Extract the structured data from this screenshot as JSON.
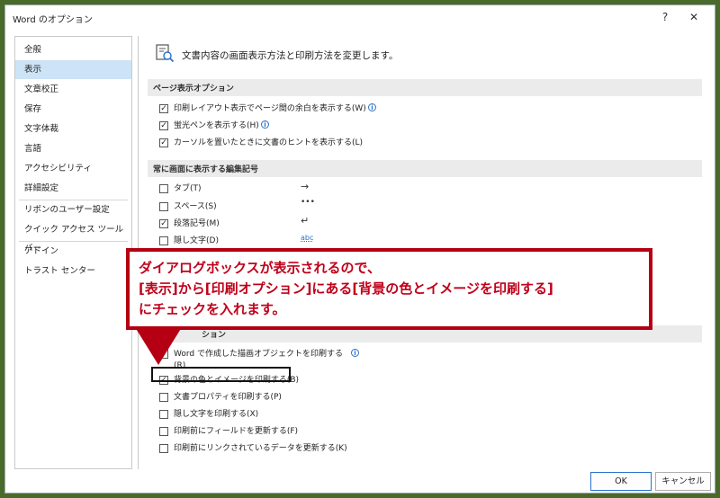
{
  "window": {
    "title": "Word のオプション",
    "help": "?",
    "close": "✕"
  },
  "sidebar": {
    "items": [
      {
        "label": "全般"
      },
      {
        "label": "表示"
      },
      {
        "label": "文章校正"
      },
      {
        "label": "保存"
      },
      {
        "label": "文字体裁"
      },
      {
        "label": "言語"
      },
      {
        "label": "アクセシビリティ"
      },
      {
        "label": "詳細設定"
      },
      {
        "label": "リボンのユーザー設定"
      },
      {
        "label": "クイック アクセス ツール バー"
      },
      {
        "label": "アドイン"
      },
      {
        "label": "トラスト センター"
      }
    ],
    "active": "表示"
  },
  "main": {
    "header": "文書内容の画面表示方法と印刷方法を変更します。",
    "page_options": {
      "title": "ページ表示オプション",
      "items": [
        {
          "label": "印刷レイアウト表示でページ間の余白を表示する(W)",
          "checked": true,
          "info": true
        },
        {
          "label": "蛍光ペンを表示する(H)",
          "checked": true,
          "info": true
        },
        {
          "label": "カーソルを置いたときに文書のヒントを表示する(L)",
          "checked": true,
          "info": false
        }
      ]
    },
    "format_marks": {
      "title": "常に画面に表示する編集記号",
      "items": [
        {
          "label": "タブ(T)",
          "checked": false,
          "symbol": "→"
        },
        {
          "label": "スペース(S)",
          "checked": false,
          "symbol": "•••"
        },
        {
          "label": "段落記号(M)",
          "checked": true,
          "symbol": "↵"
        },
        {
          "label": "隠し文字(D)",
          "checked": false,
          "symbol": "abc"
        }
      ]
    },
    "print_options": {
      "title_partial": "ション",
      "items": [
        {
          "label": "Word で作成した描画オブジェクトを印刷する",
          "label_line2": "(R)",
          "checked": true,
          "info": true
        },
        {
          "label": "背景の色とイメージを印刷する(B)",
          "checked": true
        },
        {
          "label": "文書プロパティを印刷する(P)",
          "checked": false
        },
        {
          "label": "隠し文字を印刷する(X)",
          "checked": false
        },
        {
          "label": "印刷前にフィールドを更新する(F)",
          "checked": false
        },
        {
          "label": "印刷前にリンクされているデータを更新する(K)",
          "checked": false
        }
      ]
    }
  },
  "callout": {
    "line1": "ダイアログボックスが表示されるので、",
    "line2": "[表示]から[印刷オプション]にある[背景の色とイメージを印刷する]",
    "line3": "にチェックを入れます。",
    "color": "#c0001a"
  },
  "footer": {
    "ok": "OK",
    "cancel": "キャンセル"
  },
  "colors": {
    "background": "#4a6a2c",
    "active_sidebar": "#cde3f6",
    "accent": "#2a72c8",
    "callout_border": "#b40012"
  }
}
